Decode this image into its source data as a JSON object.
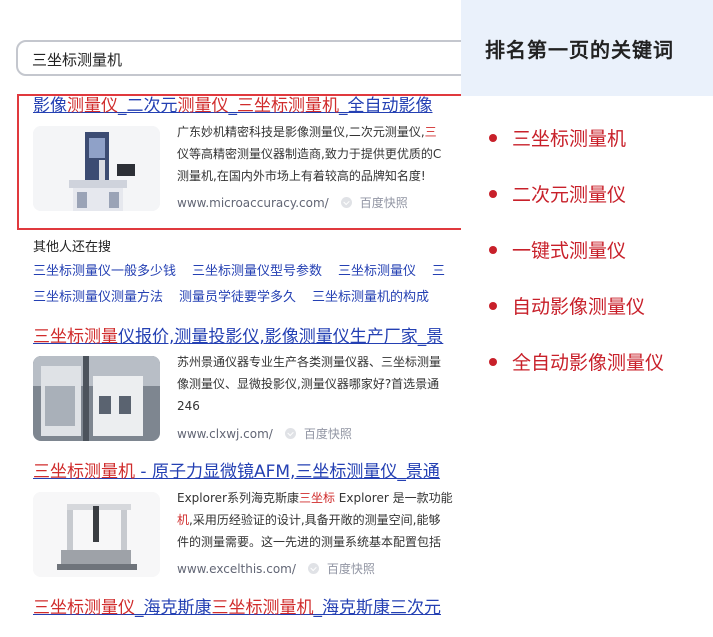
{
  "search": {
    "query": "三坐标测量机"
  },
  "results": [
    {
      "title": [
        {
          "t": "影像",
          "h": false
        },
        {
          "t": "测量仪",
          "h": true
        },
        {
          "t": "_二次元",
          "h": false
        },
        {
          "t": "测量仪",
          "h": true
        },
        {
          "t": "_",
          "h": false
        },
        {
          "t": "三坐标测量机",
          "h": true
        },
        {
          "t": "_全自动影像",
          "h": false
        }
      ],
      "snippet_lines": [
        [
          {
            "t": "广东妙机精密科技是影像测量仪,二次元测量仪,",
            "h": false
          },
          {
            "t": "三",
            "h": true
          }
        ],
        [
          {
            "t": "仪等高精密测量仪器制造商,致力于提供更优质的C",
            "h": false
          }
        ],
        [
          {
            "t": "测量机,在国内外市场上有着较高的品牌知名度!",
            "h": false
          }
        ]
      ],
      "url": "www.microaccuracy.com/",
      "cache": "百度快照"
    },
    {
      "title": [
        {
          "t": "三坐标测量",
          "h": true
        },
        {
          "t": "仪报价,测量投影仪,影像测量仪生产厂家_景",
          "h": false
        }
      ],
      "snippet_lines": [
        [
          {
            "t": "苏州景通仪器专业生产各类测量仪器、三坐标测量",
            "h": false
          }
        ],
        [
          {
            "t": "像测量仪、显微投影仪,测量仪器哪家好?首选景通",
            "h": false
          }
        ],
        [
          {
            "t": "246",
            "h": false
          }
        ]
      ],
      "url": "www.clxwj.com/",
      "cache": "百度快照"
    },
    {
      "title": [
        {
          "t": "三坐标测量机",
          "h": true
        },
        {
          "t": " - 原子力显微镜AFM,三坐标测量仪_景通",
          "h": false
        }
      ],
      "snippet_lines": [
        [
          {
            "t": "Explorer系列海克斯康",
            "h": false
          },
          {
            "t": "三坐标",
            "h": true
          },
          {
            "t": " Explorer 是一款功能",
            "h": false
          }
        ],
        [
          {
            "t": "机",
            "h": true
          },
          {
            "t": ",采用历经验证的设计,具备开敞的测量空间,能够",
            "h": false
          }
        ],
        [
          {
            "t": "件的测量需要。这一先进的测量系统基本配置包括",
            "h": false
          }
        ]
      ],
      "url": "www.excelthis.com/",
      "cache": "百度快照"
    },
    {
      "title": [
        {
          "t": "三坐标测量仪",
          "h": true
        },
        {
          "t": "_海克斯康",
          "h": false
        },
        {
          "t": "三坐标测量机",
          "h": true
        },
        {
          "t": "_海克斯康三次元",
          "h": false
        }
      ]
    }
  ],
  "related": {
    "title": "其他人还在搜",
    "rows": [
      [
        "三坐标测量仪一般多少钱",
        "三坐标测量仪型号参数",
        "三坐标测量仪",
        "三"
      ],
      [
        "三坐标测量仪测量方法",
        "测量员学徒要学多久",
        "三坐标测量机的构成"
      ]
    ]
  },
  "panel": {
    "title": "排名第一页的关键词",
    "keywords": [
      "三坐标测量机",
      "二次元测量仪",
      "一键式测量仪",
      "自动影像测量仪",
      "全自动影像测量仪"
    ],
    "accent": "#c8202a"
  },
  "colors": {
    "link": "#2440b3",
    "highlight": "#d02c2c",
    "frame": "#e0393e",
    "panel_bg": "#eaf1fb"
  }
}
